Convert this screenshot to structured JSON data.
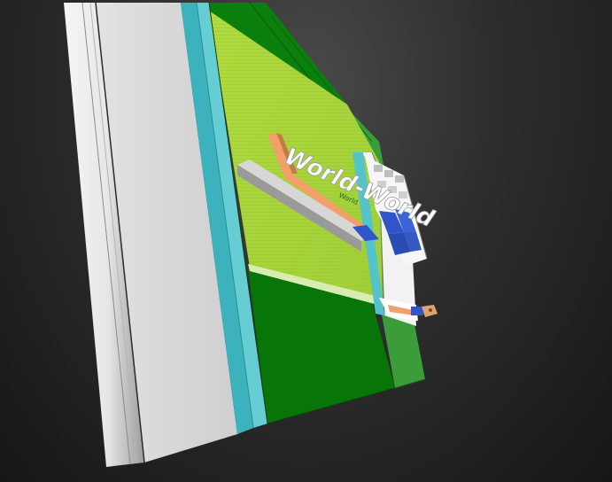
{
  "viewer": {
    "background": {
      "top": "#4a4a4a",
      "bottom": "#161616"
    },
    "palette": {
      "white_slab": "#d3d3d3",
      "white_slab_edge": "#f4f4f4",
      "cyan_frame": "#3fb3bd",
      "cyan_frame_light": "#6fd0d6",
      "green_dark": "#087a08",
      "green_mid": "#3a9c3a",
      "lime_panel": "#a7d63a",
      "orange_bar": "#f2a06a",
      "blue_button": "#2f55c8"
    }
  },
  "scene": {
    "banner_text": "World-World",
    "banner_subtext": "World"
  }
}
